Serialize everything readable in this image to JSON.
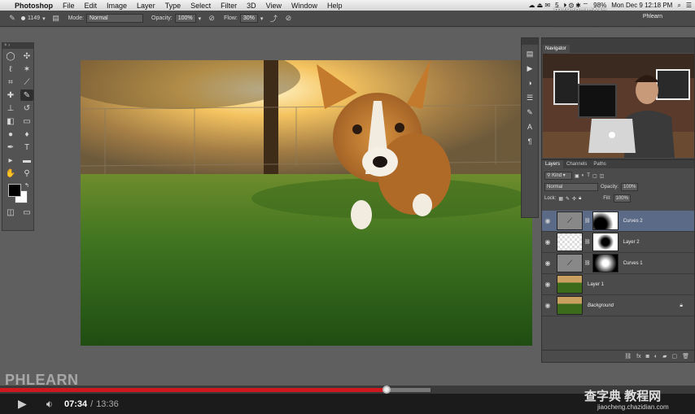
{
  "menubar": {
    "apple": "",
    "app": "Photoshop",
    "items": [
      "File",
      "Edit",
      "Image",
      "Layer",
      "Type",
      "Select",
      "Filter",
      "3D",
      "View",
      "Window",
      "Help"
    ],
    "status_num": "5",
    "battery": "98%",
    "clock": "Mon Dec 9  12:18 PM"
  },
  "options": {
    "brush_size": "1149",
    "mode_label": "Mode:",
    "mode_value": "Normal",
    "opacity_label": "Opacity:",
    "opacity_value": "100%",
    "flow_label": "Flow:",
    "flow_value": "30%"
  },
  "workspace_label": "Phlearn",
  "navigator": {
    "tab": "Navigator"
  },
  "layers": {
    "tabs": [
      "Layers",
      "Channels",
      "Paths"
    ],
    "kind": "Kind",
    "blend": "Normal",
    "opacity_label": "Opacity:",
    "opacity_value": "100%",
    "lock_label": "Lock:",
    "fill_label": "Fill:",
    "fill_value": "100%",
    "rows": [
      {
        "name": "Curves 2"
      },
      {
        "name": "Layer 2"
      },
      {
        "name": "Curves 1"
      },
      {
        "name": "Layer 1"
      },
      {
        "name": "Background"
      }
    ]
  },
  "player": {
    "current_time": "07:34",
    "separator": "/",
    "duration": "13:36",
    "progress": 0.556,
    "loaded": 0.62
  },
  "watermarks": {
    "phlearn": "PHLEARN",
    "site_cn": "查字典 教程网",
    "site_url": "jiaocheng.chazidian.com",
    "top": "思缘设计论坛  WWW.MISSYUAN.COM"
  },
  "colors": {
    "progress_red": "#cc181e",
    "layer_selected": "#5b6a86"
  }
}
